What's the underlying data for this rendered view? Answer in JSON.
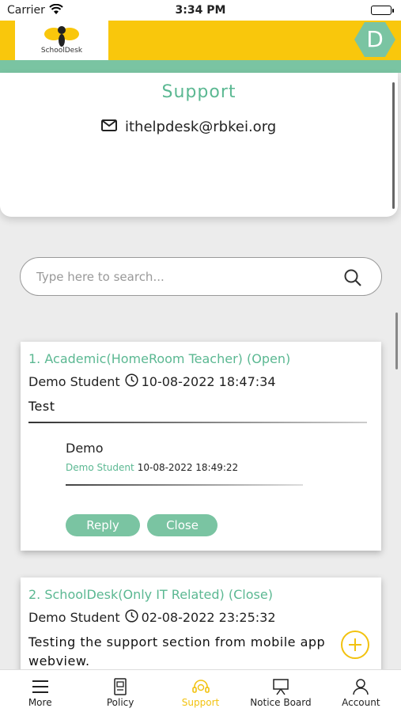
{
  "status_bar": {
    "carrier": "Carrier",
    "time": "3:34 PM"
  },
  "header": {
    "logo_text": "SchoolDesk",
    "avatar_initial": "D"
  },
  "support": {
    "title": "Support",
    "email": "ithelpdesk@rbkei.org"
  },
  "search": {
    "placeholder": "Type here to search..."
  },
  "tickets": [
    {
      "title": "1. Academic(HomeRoom Teacher) (Open)",
      "author": "Demo Student",
      "datetime": "10-08-2022 18:47:34",
      "message": "Test",
      "reply": {
        "message": "Demo",
        "author": "Demo Student",
        "datetime": "10-08-2022 18:49:22"
      },
      "reply_label": "Reply",
      "close_label": "Close"
    },
    {
      "title": "2. SchoolDesk(Only IT Related) (Close)",
      "author": "Demo Student",
      "datetime": "02-08-2022 23:25:32",
      "message": "Testing the support section from mobile app webview."
    }
  ],
  "nav": [
    {
      "label": "More",
      "icon": "menu-icon"
    },
    {
      "label": "Policy",
      "icon": "policy-icon"
    },
    {
      "label": "Support",
      "icon": "headset-icon",
      "active": true
    },
    {
      "label": "Notice Board",
      "icon": "board-icon"
    },
    {
      "label": "Account",
      "icon": "user-icon"
    }
  ],
  "colors": {
    "brand_yellow": "#f9c70c",
    "accent_green": "#5bb892",
    "button_green": "#7ac4a2"
  }
}
